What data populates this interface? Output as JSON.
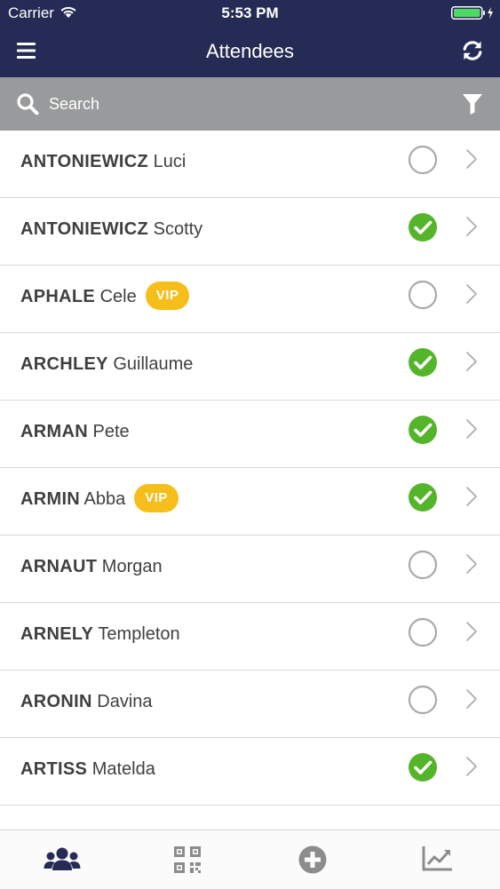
{
  "status_bar": {
    "carrier": "Carrier",
    "time": "5:53 PM"
  },
  "nav": {
    "title": "Attendees"
  },
  "search": {
    "placeholder": "Search",
    "value": ""
  },
  "attendees": [
    {
      "last": "ANTONIEWICZ",
      "first": "Luci",
      "vip": false,
      "checked_in": false
    },
    {
      "last": "ANTONIEWICZ",
      "first": "Scotty",
      "vip": false,
      "checked_in": true
    },
    {
      "last": "APHALE",
      "first": "Cele",
      "vip": true,
      "checked_in": false
    },
    {
      "last": "ARCHLEY",
      "first": "Guillaume",
      "vip": false,
      "checked_in": true
    },
    {
      "last": "ARMAN",
      "first": "Pete",
      "vip": false,
      "checked_in": true
    },
    {
      "last": "ARMIN",
      "first": "Abba",
      "vip": true,
      "checked_in": true
    },
    {
      "last": "ARNAUT",
      "first": "Morgan",
      "vip": false,
      "checked_in": false
    },
    {
      "last": "ARNELY",
      "first": "Templeton",
      "vip": false,
      "checked_in": false
    },
    {
      "last": "ARONIN",
      "first": "Davina",
      "vip": false,
      "checked_in": false
    },
    {
      "last": "ARTISS",
      "first": "Matelda",
      "vip": false,
      "checked_in": true
    }
  ],
  "vip_label": "VIP",
  "tabs": [
    {
      "name": "attendees",
      "icon": "users-icon",
      "active": true
    },
    {
      "name": "scan",
      "icon": "qr-code-icon",
      "active": false
    },
    {
      "name": "add",
      "icon": "plus-circle-icon",
      "active": false
    },
    {
      "name": "stats",
      "icon": "line-chart-icon",
      "active": false
    }
  ],
  "colors": {
    "header_bg": "#262b55",
    "search_bg": "#999a9b",
    "checked": "#55b52a",
    "unchecked": "#a9a9a9",
    "vip_badge": "#f5be1a",
    "active_tab": "#262b55",
    "inactive_tab": "#8c8c8c"
  }
}
